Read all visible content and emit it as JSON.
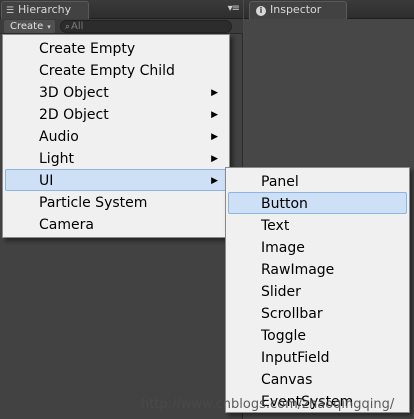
{
  "hierarchy": {
    "tab_label": "Hierarchy",
    "tab_icon": "list-icon",
    "create_label": "Create",
    "create_caret": "▾",
    "search_placeholder": "All",
    "search_icon": "search-icon",
    "panel_menu_icon": "panel-options-icon"
  },
  "inspector": {
    "tab_label": "Inspector",
    "tab_icon": "info-icon"
  },
  "context_menu": {
    "items": [
      {
        "label": "Create Empty",
        "has_submenu": false
      },
      {
        "label": "Create Empty Child",
        "has_submenu": false
      },
      {
        "label": "3D Object",
        "has_submenu": true
      },
      {
        "label": "2D Object",
        "has_submenu": true
      },
      {
        "label": "Audio",
        "has_submenu": true
      },
      {
        "label": "Light",
        "has_submenu": true
      },
      {
        "label": "UI",
        "has_submenu": true,
        "highlighted": true
      },
      {
        "label": "Particle System",
        "has_submenu": false
      },
      {
        "label": "Camera",
        "has_submenu": false
      }
    ]
  },
  "ui_submenu": {
    "items": [
      {
        "label": "Panel"
      },
      {
        "label": "Button",
        "highlighted": true
      },
      {
        "label": "Text"
      },
      {
        "label": "Image"
      },
      {
        "label": "RawImage"
      },
      {
        "label": "Slider"
      },
      {
        "label": "Scrollbar"
      },
      {
        "label": "Toggle"
      },
      {
        "label": "InputField"
      },
      {
        "label": "Canvas"
      },
      {
        "label": "EventSystem"
      }
    ]
  },
  "watermark": "http://www.cnblogs.com/zhaoqingqing/",
  "colors": {
    "menu_bg": "#f0f0f0",
    "highlight_bg": "#cde0f5",
    "highlight_border": "#8eb4e0",
    "panel_bg": "#424242"
  }
}
